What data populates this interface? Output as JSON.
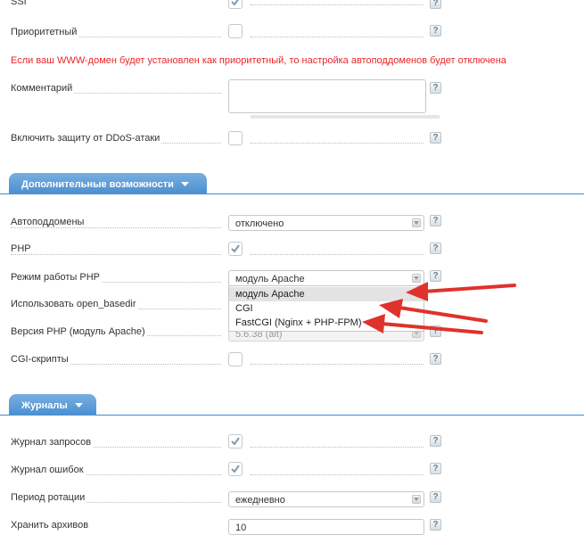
{
  "rows_top": {
    "ssi": {
      "label": "SSI",
      "checked": true
    },
    "priority": {
      "label": "Приоритетный",
      "checked": false
    },
    "warning": "Если ваш WWW-домен будет установлен как приоритетный, то настройка автоподдоменов будет отключена",
    "comment": {
      "label": "Комментарий",
      "value": ""
    },
    "ddos": {
      "label": "Включить защиту от DDoS-атаки",
      "checked": false
    }
  },
  "section_extra": {
    "title": "Дополнительные возможности",
    "autosub": {
      "label": "Автоподдомены",
      "value": "отключено"
    },
    "php": {
      "label": "PHP",
      "checked": true
    },
    "php_mode": {
      "label": "Режим работы PHP",
      "value": "модуль Apache",
      "options": [
        "модуль Apache",
        "CGI",
        "FastCGI (Nginx + PHP-FPM)"
      ]
    },
    "open_basedir": {
      "label": "Использовать open_basedir"
    },
    "php_version": {
      "label": "Версия PHP (модуль Apache)",
      "value": "5.6.38 (alt)"
    },
    "cgi": {
      "label": "CGI-скрипты",
      "checked": false
    }
  },
  "section_logs": {
    "title": "Журналы",
    "access_log": {
      "label": "Журнал запросов",
      "checked": true
    },
    "error_log": {
      "label": "Журнал ошибок",
      "checked": true
    },
    "rotation": {
      "label": "Период ротации",
      "value": "ежедневно"
    },
    "archives": {
      "label": "Хранить архивов",
      "value": "10"
    }
  },
  "help_glyph": "?",
  "colors": {
    "accent": "#4a8fd0",
    "warning": "#e8262a",
    "arrow": "#e0322c"
  }
}
